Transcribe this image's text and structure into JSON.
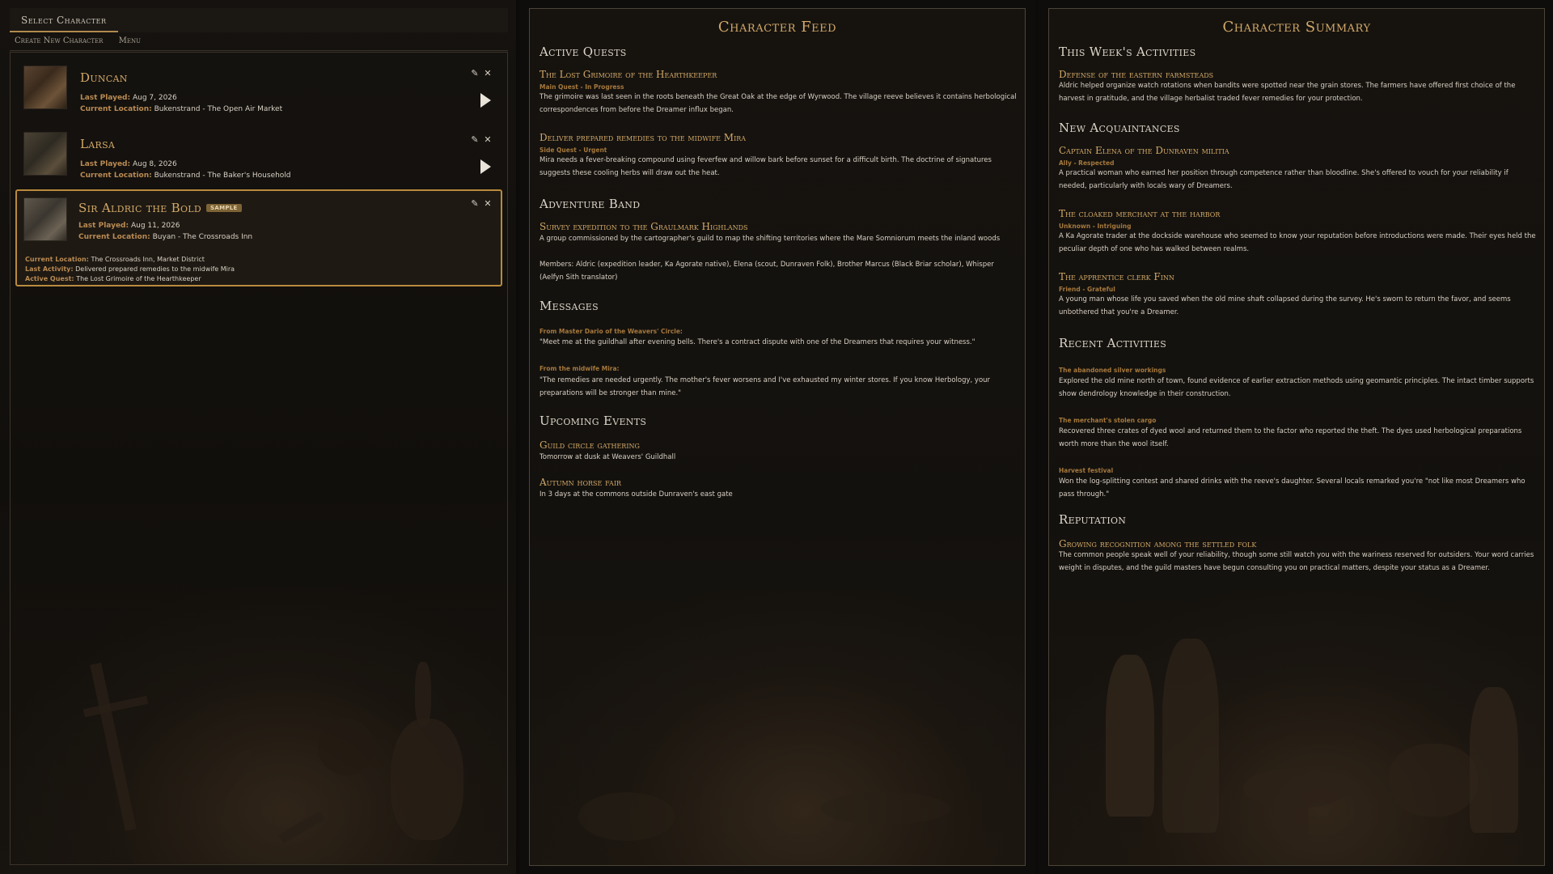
{
  "left": {
    "tab_select": "Select Character",
    "create_new": "Create New Character",
    "menu": "Menu",
    "characters": [
      {
        "name": "Duncan",
        "last_played_label": "Last Played:",
        "last_played": "Aug 7, 2026",
        "location_label": "Current Location:",
        "location": "Bukenstrand - The Open Air Market"
      },
      {
        "name": "Larsa",
        "last_played_label": "Last Played:",
        "last_played": "Aug 8, 2026",
        "location_label": "Current Location:",
        "location": "Bukenstrand - The Baker's Household"
      },
      {
        "name": "Sir Aldric the Bold",
        "badge": "SAMPLE",
        "last_played_label": "Last Played:",
        "last_played": "Aug 11, 2026",
        "location_label": "Current Location:",
        "location": "Buyan - The Crossroads Inn",
        "detail_location_label": "Current Location:",
        "detail_location": "The Crossroads Inn, Market District",
        "detail_activity_label": "Last Activity:",
        "detail_activity": "Delivered prepared remedies to the midwife Mira",
        "detail_quest_label": "Active Quest:",
        "detail_quest": "The Lost Grimoire of the Hearthkeeper"
      }
    ]
  },
  "feed": {
    "title": "Character Feed",
    "active_quests": "Active Quests",
    "quest1_title": "The Lost Grimoire of the Hearthkeeper",
    "quest1_tag": "Main Quest - In Progress",
    "quest1_body": "The grimoire was last seen in the roots beneath the Great Oak at the edge of Wyrwood. The village reeve believes it contains herbological correspondences from before the Dreamer influx began.",
    "quest2_title": "Deliver prepared remedies to the midwife Mira",
    "quest2_tag": "Side Quest - Urgent",
    "quest2_body": "Mira needs a fever-breaking compound using feverfew and willow bark before sunset for a difficult birth. The doctrine of signatures suggests these cooling herbs will draw out the heat.",
    "adventure_band": "Adventure Band",
    "band_title": "Survey expedition to the Graulmark Highlands",
    "band_body": "A group commissioned by the cartographer's guild to map the shifting territories where the Mare Somniorum meets the inland woods",
    "band_members": "Members: Aldric (expedition leader, Ka Agorate native), Elena (scout, Dunraven Folk), Brother Marcus (Black Briar scholar), Whisper (Aelfyn Sith translator)",
    "messages": "Messages",
    "msg1_from": "From Master Dario of the Weavers' Circle:",
    "msg1_body": "\"Meet me at the guildhall after evening bells. There's a contract dispute with one of the Dreamers that requires your witness.\"",
    "msg2_from": "From the midwife Mira:",
    "msg2_body": "\"The remedies are needed urgently. The mother's fever worsens and I've exhausted my winter stores. If you know Herbology, your preparations will be stronger than mine.\"",
    "upcoming_events": "Upcoming Events",
    "event1_title": "Guild circle gathering",
    "event1_body": "Tomorrow at dusk at Weavers' Guildhall",
    "event2_title": "Autumn horse fair",
    "event2_body": "In 3 days at the commons outside Dunraven's east gate"
  },
  "summary": {
    "title": "Character Summary",
    "this_week": "This Week's Activities",
    "week1_title": "Defense of the eastern farmsteads",
    "week1_body": "Aldric helped organize watch rotations when bandits were spotted near the grain stores. The farmers have offered first choice of the harvest in gratitude, and the village herbalist traded fever remedies for your protection.",
    "new_acq": "New Acquaintances",
    "acq1_title": "Captain Elena of the Dunraven militia",
    "acq1_tag": "Ally - Respected",
    "acq1_body": "A practical woman who earned her position through competence rather than bloodline. She's offered to vouch for your reliability if needed, particularly with locals wary of Dreamers.",
    "acq2_title": "The cloaked merchant at the harbor",
    "acq2_tag": "Unknown - Intriguing",
    "acq2_body": "A Ka Agorate trader at the dockside warehouse who seemed to know your reputation before introductions were made. Their eyes held the peculiar depth of one who has walked between realms.",
    "acq3_title": "The apprentice clerk Finn",
    "acq3_tag": "Friend - Grateful",
    "acq3_body": "A young man whose life you saved when the old mine shaft collapsed during the survey. He's sworn to return the favor, and seems unbothered that you're a Dreamer.",
    "recent": "Recent Activities",
    "rec1_tag": "The abandoned silver workings",
    "rec1_body": "Explored the old mine north of town, found evidence of earlier extraction methods using geomantic principles. The intact timber supports show dendrology knowledge in their construction.",
    "rec2_tag": "The merchant's stolen cargo",
    "rec2_body": "Recovered three crates of dyed wool and returned them to the factor who reported the theft. The dyes used herbological preparations worth more than the wool itself.",
    "rec3_tag": "Harvest festival",
    "rec3_body": "Won the log-splitting contest and shared drinks with the reeve's daughter. Several locals remarked you're \"not like most Dreamers who pass through.\"",
    "reputation": "Reputation",
    "rep_title": "Growing recognition among the settled folk",
    "rep_body": "The common people speak well of your reliability, though some still watch you with the wariness reserved for outsiders. Your word carries weight in disputes, and the guild masters have begun consulting you on practical matters, despite your status as a Dreamer."
  }
}
